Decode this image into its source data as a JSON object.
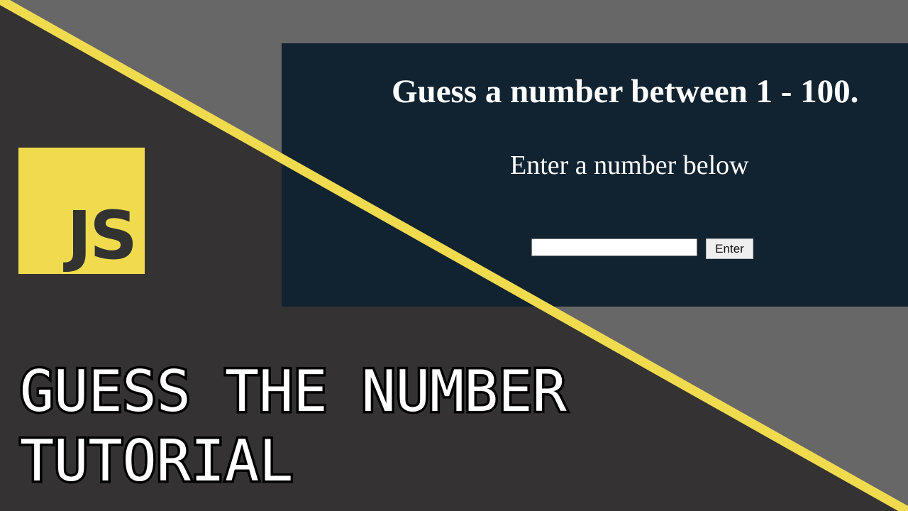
{
  "app": {
    "heading": "Guess a number between 1 - 100.",
    "instruction": "Enter a number below",
    "input": {
      "value": "",
      "placeholder": ""
    },
    "enter_button_label": "Enter"
  },
  "logo": {
    "text": "JS"
  },
  "title": {
    "line1": "GUESS THE NUMBER",
    "line2": "TUTORIAL"
  },
  "colors": {
    "background_dark": "#343233",
    "background_gray": "#686768",
    "accent_yellow": "#f0db4f",
    "panel_navy": "#112331",
    "logo_text": "#323330"
  },
  "icons": {
    "logo": "javascript-logo-icon"
  }
}
